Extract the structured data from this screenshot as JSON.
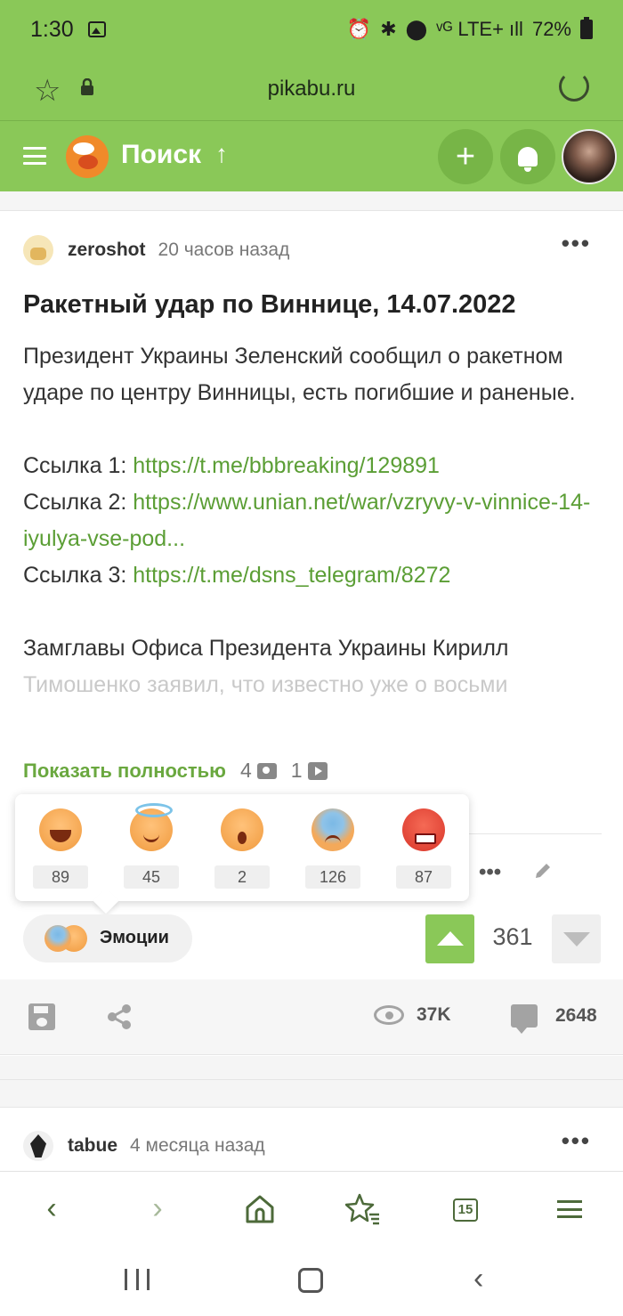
{
  "status_bar": {
    "time": "1:30",
    "signal_text": "ᵛᴳ LTE+ ıll",
    "battery": "72%"
  },
  "browser": {
    "url": "pikabu.ru"
  },
  "header": {
    "search_label": "Поиск",
    "search_arrow": "↑",
    "plus_label": "+"
  },
  "post": {
    "author": "zeroshot",
    "time_ago": "20 часов назад",
    "menu": "•••",
    "title": "Ракетный удар по Виннице, 14.07.2022",
    "paragraph1": "Президент Украины Зеленский сообщил о ракетном ударе по центру Винницы, есть погибшие и раненые.",
    "links": [
      {
        "label": "Ссылка 1: ",
        "url": "https://t.me/bbbreaking/129891"
      },
      {
        "label": "Ссылка 2: ",
        "url": "https://www.unian.net/war/vzryvy-v-vinnice-14-iyulya-vse-pod..."
      },
      {
        "label": "Ссылка 3: ",
        "url": "https://t.me/dsns_telegram/8272"
      }
    ],
    "paragraph2": "Замглавы Офиса Президента Украины Кирилл",
    "paragraph2_faded": "Тимошенко заявил, что известно уже о восьми",
    "show_full": "Показать полностью",
    "photo_count": "4",
    "video_count": "1",
    "emotions": [
      {
        "icon": "laughing-face-icon",
        "count": "89"
      },
      {
        "icon": "angel-face-icon",
        "count": "45"
      },
      {
        "icon": "shocked-face-icon",
        "count": "2"
      },
      {
        "icon": "sad-face-icon",
        "count": "126"
      },
      {
        "icon": "angry-face-icon",
        "count": "87"
      }
    ],
    "emotions_button": "Эмоции",
    "rating": "361",
    "views": "37K",
    "comments": "2648",
    "action_dots": "•••"
  },
  "post2": {
    "author": "tabue",
    "time_ago": "4 месяца назад",
    "menu": "•••"
  },
  "browser_nav": {
    "back": "‹",
    "forward": "›",
    "tabs_count": "15"
  },
  "colors": {
    "brand_green": "#8ac858",
    "link_green": "#5b9e35",
    "accent_orange": "#f08a2a"
  }
}
